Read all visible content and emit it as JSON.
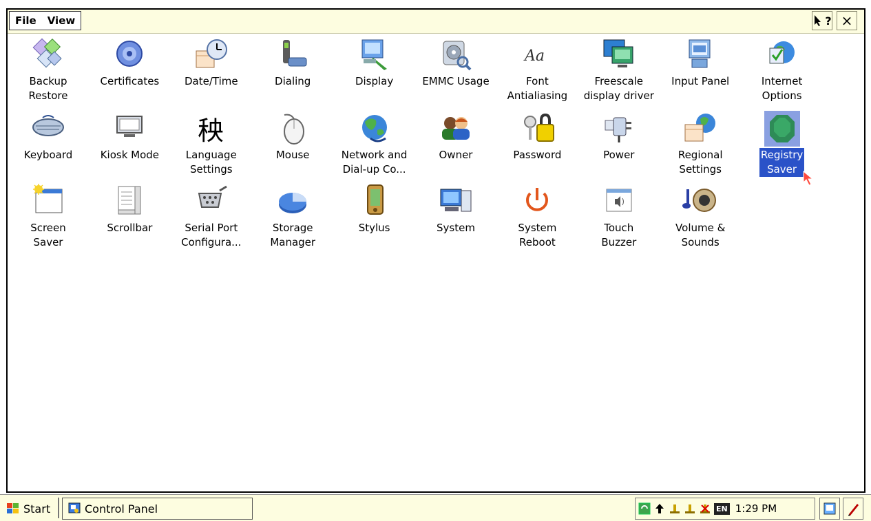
{
  "menu": {
    "file": "File",
    "view": "View"
  },
  "header": {
    "help": "?",
    "close": "×"
  },
  "items": [
    {
      "label": "Backup\nRestore",
      "icon": "backup-restore-icon"
    },
    {
      "label": "Certificates",
      "icon": "certificates-icon"
    },
    {
      "label": "Date/Time",
      "icon": "clock-calendar-icon"
    },
    {
      "label": "Dialing",
      "icon": "phone-modem-icon"
    },
    {
      "label": "Display",
      "icon": "display-icon"
    },
    {
      "label": "EMMC Usage",
      "icon": "disk-magnifier-icon"
    },
    {
      "label": "Font\nAntialiasing",
      "icon": "font-aa-icon",
      "glyph": "Aa"
    },
    {
      "label": "Freescale\ndisplay driver",
      "icon": "monitors-icon"
    },
    {
      "label": "Input Panel",
      "icon": "keyboard-monitor-icon"
    },
    {
      "label": "Internet\nOptions",
      "icon": "globe-check-icon"
    },
    {
      "label": "Keyboard",
      "icon": "keyboard-icon"
    },
    {
      "label": "Kiosk Mode",
      "icon": "monitor-icon"
    },
    {
      "label": "Language\nSettings",
      "icon": "chinese-char-icon",
      "glyph": "秧"
    },
    {
      "label": "Mouse",
      "icon": "mouse-icon"
    },
    {
      "label": "Network and\nDial-up Co...",
      "icon": "network-globe-icon"
    },
    {
      "label": "Owner",
      "icon": "owner-icon"
    },
    {
      "label": "Password",
      "icon": "keys-padlock-icon"
    },
    {
      "label": "Power",
      "icon": "power-plug-icon"
    },
    {
      "label": "Regional\nSettings",
      "icon": "globe-calendar-icon"
    },
    {
      "label": "Registry\nSaver",
      "icon": "registry-saver-icon",
      "selected": true
    },
    {
      "label": "Screen\nSaver",
      "icon": "screen-saver-icon"
    },
    {
      "label": "Scrollbar",
      "icon": "scrollbar-icon"
    },
    {
      "label": "Serial Port\nConfigura...",
      "icon": "serial-port-icon"
    },
    {
      "label": "Storage\nManager",
      "icon": "storage-pie-icon"
    },
    {
      "label": "Stylus",
      "icon": "stylus-pda-icon"
    },
    {
      "label": "System",
      "icon": "computer-icon"
    },
    {
      "label": "System\nReboot",
      "icon": "power-button-icon"
    },
    {
      "label": "Touch\nBuzzer",
      "icon": "speaker-window-icon"
    },
    {
      "label": "Volume &\nSounds",
      "icon": "speaker-note-icon"
    }
  ],
  "taskbar": {
    "start": "Start",
    "task": "Control Panel",
    "lang": "EN",
    "time": "1:29 PM"
  },
  "colors": {
    "menubar": "#fdfde0",
    "selection": "#2a52c8"
  }
}
